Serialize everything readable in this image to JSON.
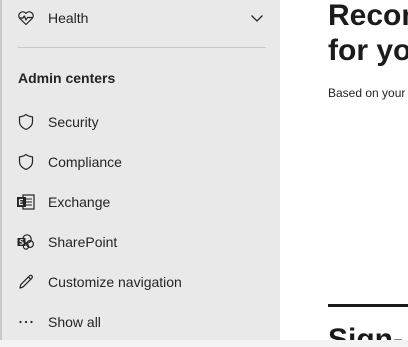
{
  "sidebar": {
    "health": {
      "label": "Health",
      "icon": "heart-pulse-icon"
    },
    "section_header": "Admin centers",
    "items": [
      {
        "label": "Security",
        "icon": "shield-icon"
      },
      {
        "label": "Compliance",
        "icon": "shield-icon"
      },
      {
        "label": "Exchange",
        "icon": "exchange-icon"
      },
      {
        "label": "SharePoint",
        "icon": "sharepoint-icon"
      },
      {
        "label": "Customize navigation",
        "icon": "pencil-icon"
      },
      {
        "label": "Show all",
        "icon": "ellipsis-icon"
      }
    ]
  },
  "main": {
    "title": "Recommended for you",
    "subtitle": "Based on your",
    "bottom_title": "Sign-"
  },
  "colors": {
    "sidebar_bg": "#e9e9e9",
    "text": "#242424",
    "heading": "#1b1b1b"
  }
}
